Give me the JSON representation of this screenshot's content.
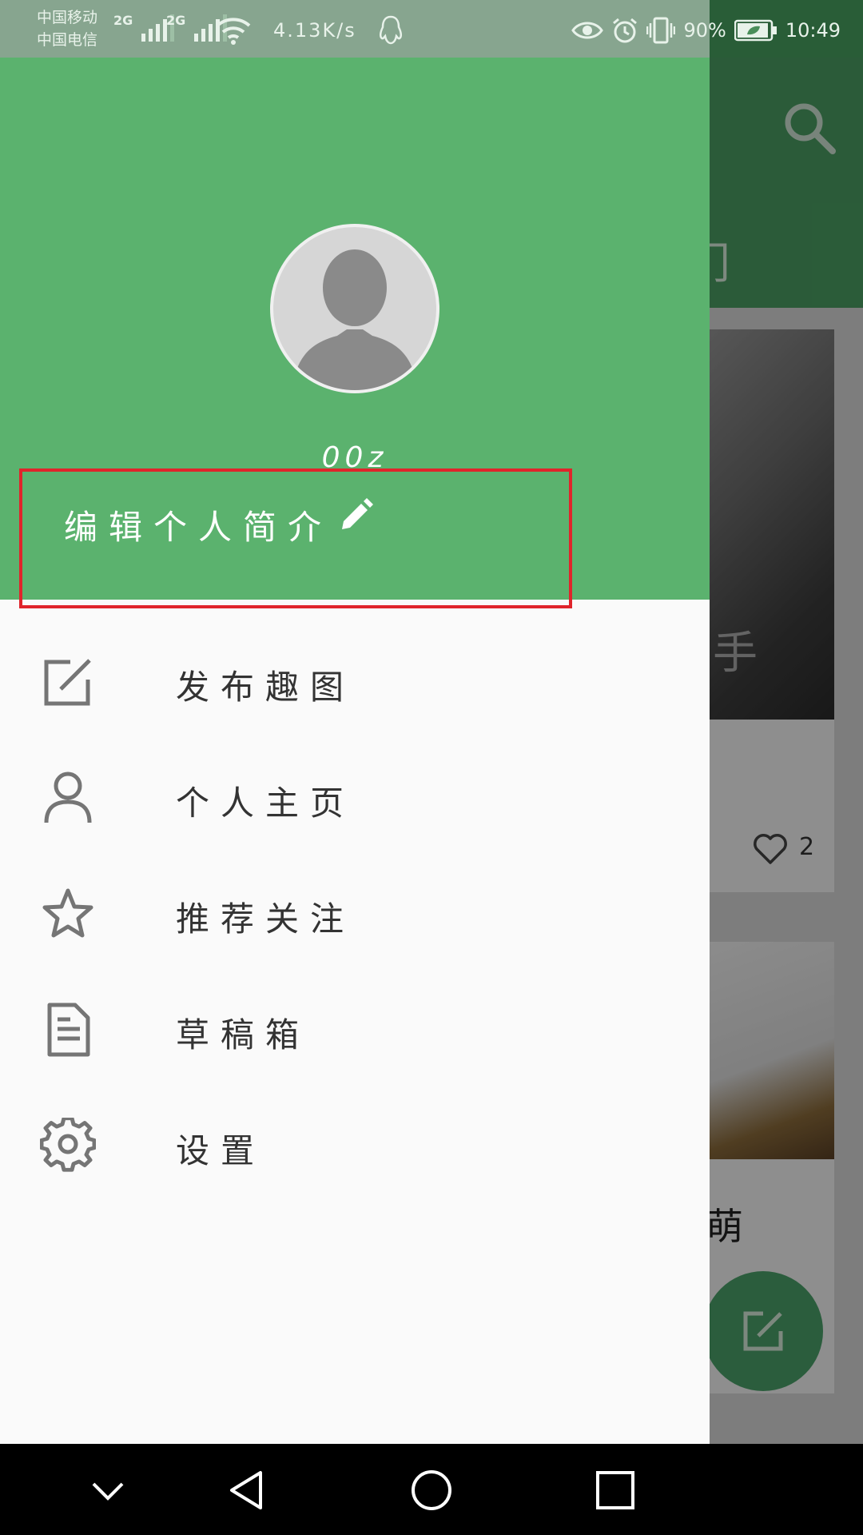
{
  "status_bar": {
    "carrier_1": "中国移动",
    "carrier_2": "中国电信",
    "sim1_network": "2G",
    "sim2_network": "2G",
    "net_speed": "4.13K/s",
    "battery": "90%",
    "time": "10:49"
  },
  "background": {
    "tab_partial": "门",
    "card1_glyph": "手",
    "card1_likes": "2",
    "card2_text": "萌"
  },
  "drawer": {
    "username": "00z",
    "edit_bio_label": "编辑个人简介",
    "menu": [
      {
        "label": "发布趣图",
        "icon": "edit-square-icon"
      },
      {
        "label": "个人主页",
        "icon": "person-icon"
      },
      {
        "label": "推荐关注",
        "icon": "star-icon"
      },
      {
        "label": "草稿箱",
        "icon": "document-icon"
      },
      {
        "label": "设置",
        "icon": "gear-icon"
      }
    ]
  },
  "colors": {
    "header_green": "#5bb26e",
    "highlight_red": "#e0242b",
    "drawer_bg": "#fafafa"
  }
}
